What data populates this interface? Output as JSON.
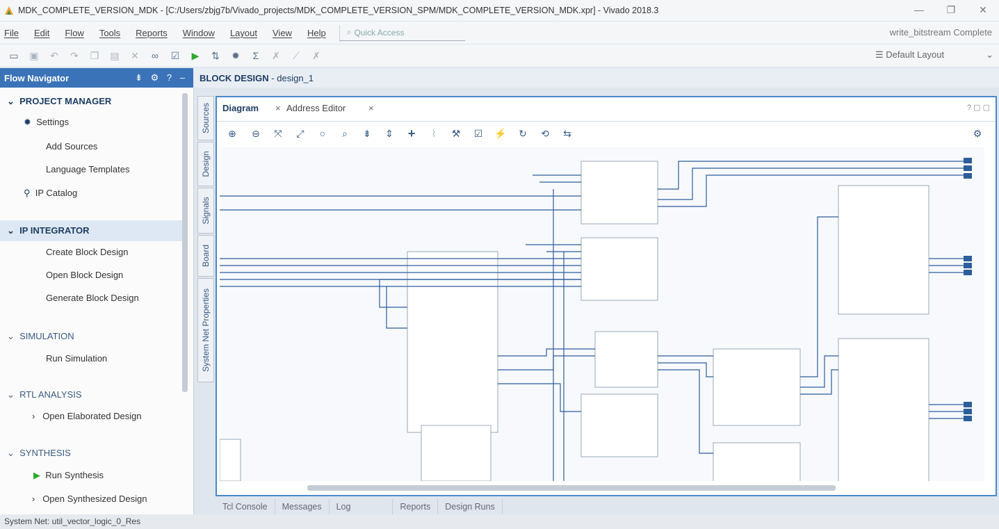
{
  "window": {
    "title": "MDK_COMPLETE_VERSION_MDK - [C:/Users/zbjg7b/Vivado_projects/MDK_COMPLETE_VERSION_SPM/MDK_COMPLETE_VERSION_MDK.xpr] - Vivado 2018.3",
    "minimize": "—",
    "maximize": "❐",
    "close": "✕"
  },
  "menu": {
    "items": [
      "File",
      "Edit",
      "Flow",
      "Tools",
      "Reports",
      "Window",
      "Layout",
      "View",
      "Help"
    ],
    "quick_access": "Quick Access",
    "status": "write_bitstream Complete"
  },
  "toolbar": {
    "layout": "Default Layout"
  },
  "flow_navigator": {
    "title": "Flow Navigator",
    "project_manager": {
      "label": "PROJECT MANAGER",
      "items": [
        "Settings",
        "Add Sources",
        "Language Templates",
        "IP Catalog"
      ]
    },
    "ip_integrator": {
      "label": "IP INTEGRATOR",
      "items": [
        "Create Block Design",
        "Open Block Design",
        "Generate Block Design"
      ]
    },
    "simulation": {
      "label": "SIMULATION",
      "items": [
        "Run Simulation"
      ]
    },
    "rtl_analysis": {
      "label": "RTL ANALYSIS",
      "items": [
        "Open Elaborated Design"
      ]
    },
    "synthesis": {
      "label": "SYNTHESIS",
      "items": [
        "Run Synthesis",
        "Open Synthesized Design"
      ]
    }
  },
  "block_design": {
    "title": "BLOCK DESIGN",
    "name": "design_1",
    "side_tabs": [
      "Sources",
      "Design",
      "Signals",
      "Board",
      "System Net Properties"
    ],
    "tabs": [
      "Diagram",
      "Address Editor"
    ]
  },
  "bottom_tabs": [
    "Tcl Console",
    "Messages",
    "Log",
    "Reports",
    "Design Runs"
  ],
  "statusbar": {
    "text": "System Net: util_vector_logic_0_Res"
  },
  "colors": {
    "accent": "#3b73b8",
    "wire": "#2d5d9a",
    "block_border": "#9aa8b8"
  }
}
